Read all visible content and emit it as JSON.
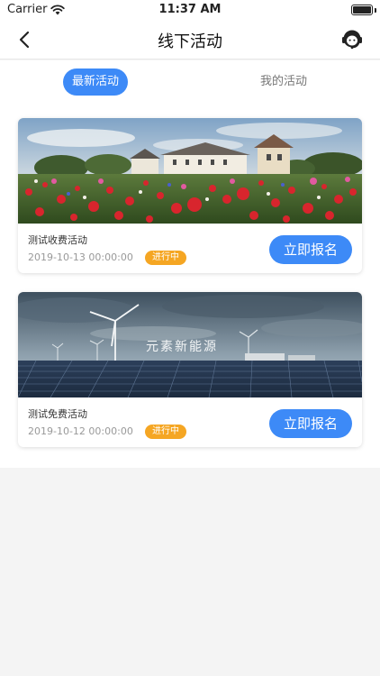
{
  "status_bar": {
    "carrier": "Carrier",
    "time": "11:37 AM"
  },
  "nav": {
    "title": "线下活动"
  },
  "tabs": [
    {
      "label": "最新活动",
      "active": true
    },
    {
      "label": "我的活动",
      "active": false
    }
  ],
  "activities": [
    {
      "title": "测试收费活动",
      "date": "2019-10-13 00:00:00",
      "status": "进行中",
      "button": "立即报名"
    },
    {
      "title": "测试免费活动",
      "date": "2019-10-12 00:00:00",
      "status": "进行中",
      "button": "立即报名",
      "image_caption": "元素新能源"
    }
  ],
  "colors": {
    "accent": "#3d8af7",
    "badge": "#f5a623"
  }
}
